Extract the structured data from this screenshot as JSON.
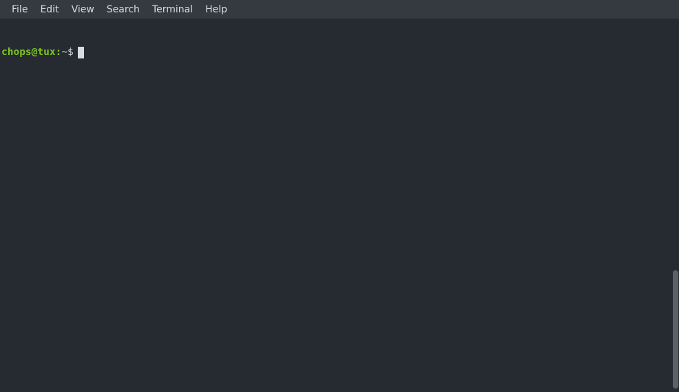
{
  "menubar": {
    "items": [
      {
        "label": "File"
      },
      {
        "label": "Edit"
      },
      {
        "label": "View"
      },
      {
        "label": "Search"
      },
      {
        "label": "Terminal"
      },
      {
        "label": "Help"
      }
    ]
  },
  "terminal": {
    "prompt_user_host": "chops@tux:",
    "prompt_path": "~$"
  }
}
